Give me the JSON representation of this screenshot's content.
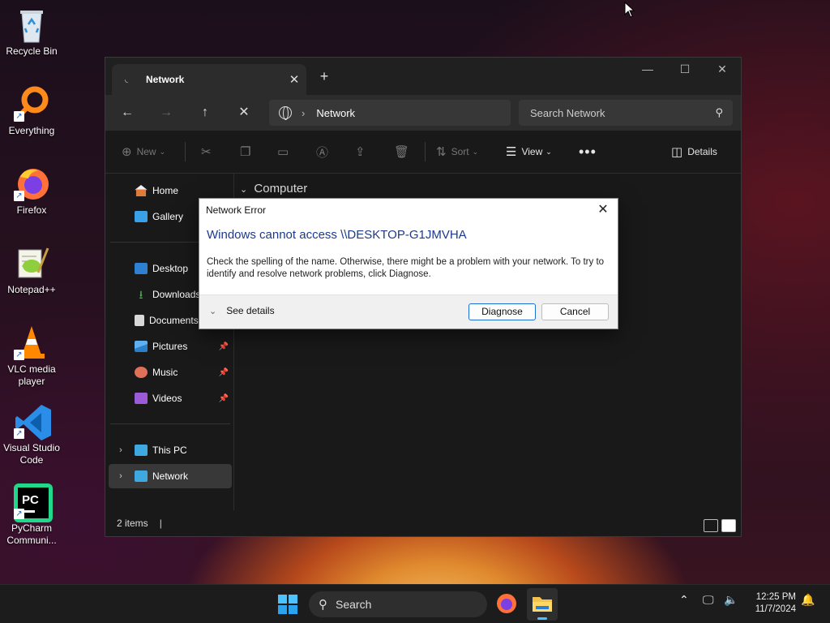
{
  "desktop": {
    "icons": [
      {
        "label": "Recycle Bin",
        "icon": "recycle-bin-icon"
      },
      {
        "label": "Everything",
        "icon": "everything-search-icon"
      },
      {
        "label": "Firefox",
        "icon": "firefox-icon"
      },
      {
        "label": "Notepad++",
        "icon": "notepad-plus-plus-icon"
      },
      {
        "label": "VLC media player",
        "icon": "vlc-cone-icon"
      },
      {
        "label": "Visual Studio Code",
        "icon": "vscode-icon"
      },
      {
        "label": "PyCharm Communi...",
        "icon": "pycharm-icon"
      }
    ]
  },
  "explorer": {
    "tab_title": "Network",
    "address": {
      "crumb": "Network"
    },
    "search_placeholder": "Search Network",
    "commands": {
      "new": "New",
      "sort": "Sort",
      "view": "View",
      "details": "Details"
    },
    "sidebar": {
      "home": "Home",
      "gallery": "Gallery",
      "desktop": "Desktop",
      "downloads": "Downloads",
      "documents": "Documents",
      "pictures": "Pictures",
      "music": "Music",
      "videos": "Videos",
      "this_pc": "This PC",
      "network": "Network"
    },
    "group_header": "Computer",
    "status": {
      "items": "2 items",
      "separator": "|"
    }
  },
  "dialog": {
    "title": "Network Error",
    "heading": "Windows cannot access \\\\DESKTOP-G1JMVHA",
    "body": "Check the spelling of the name. Otherwise, there might be a problem with your network. To try to identify and resolve network problems, click Diagnose.",
    "see_details": "See details",
    "diagnose": "Diagnose",
    "cancel": "Cancel"
  },
  "taskbar": {
    "search_label": "Search",
    "time": "12:25 PM",
    "date": "11/7/2024"
  },
  "colors": {
    "accent": "#1e6fd0",
    "dialog_heading": "#1c3a8c",
    "window_bg": "#191919"
  }
}
